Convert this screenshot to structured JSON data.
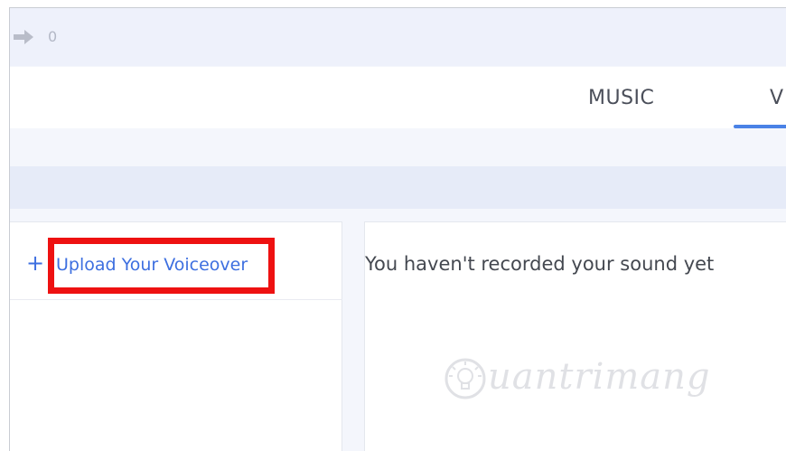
{
  "toolbar": {
    "redo_icon": "redo-arrow-icon",
    "count": "0"
  },
  "tabs": {
    "music_label": "MUSIC",
    "voice_label_visible": "V",
    "active_tab": "voice",
    "accent_color": "#4a82e6"
  },
  "upload": {
    "plus_symbol": "+",
    "link_label": "Upload Your Voiceover",
    "link_color": "#3d6fe0",
    "highlight_color": "#ee1111"
  },
  "recordings": {
    "empty_message": "You haven't recorded your sound yet"
  },
  "watermark": {
    "text": "uantrimang",
    "icon": "lightbulb-icon"
  }
}
